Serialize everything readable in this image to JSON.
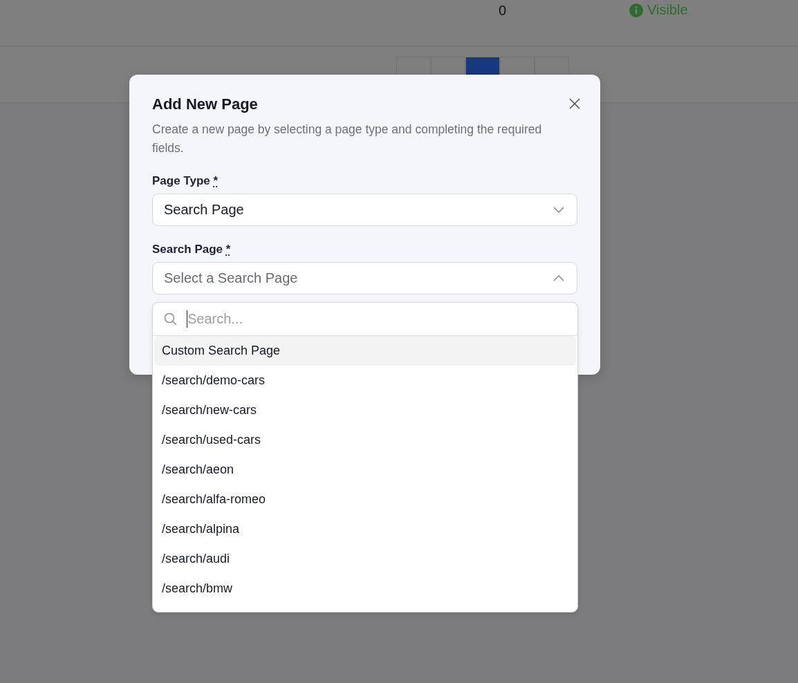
{
  "table_row": {
    "count": "0",
    "status": "Visible"
  },
  "pagination": [
    {
      "selected": false
    },
    {
      "selected": false
    },
    {
      "selected": true
    },
    {
      "selected": false
    },
    {
      "selected": false
    }
  ],
  "dialog": {
    "title": "Add New Page",
    "description": "Create a new page by selecting a page type and completing the required fields.",
    "fields": [
      {
        "label": "Page Type",
        "required_mark": "*",
        "value": "Search Page",
        "expanded": false
      },
      {
        "label": "Search Page",
        "required_mark": "*",
        "placeholder": "Select a Search Page",
        "expanded": true
      }
    ],
    "dropdown": {
      "search_placeholder": "Search...",
      "options": [
        {
          "label": "Custom Search Page",
          "selected": true
        },
        {
          "label": "/search/demo-cars",
          "selected": false
        },
        {
          "label": "/search/new-cars",
          "selected": false
        },
        {
          "label": "/search/used-cars",
          "selected": false
        },
        {
          "label": "/search/aeon",
          "selected": false
        },
        {
          "label": "/search/alfa-romeo",
          "selected": false
        },
        {
          "label": "/search/alpina",
          "selected": false
        },
        {
          "label": "/search/audi",
          "selected": false
        },
        {
          "label": "/search/bmw",
          "selected": false
        }
      ]
    }
  }
}
